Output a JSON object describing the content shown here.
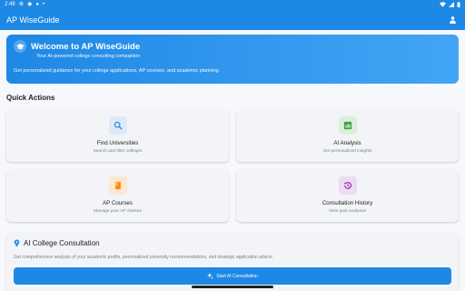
{
  "status_bar": {
    "time": "2:48"
  },
  "app_bar": {
    "title": "AP WiseGuide"
  },
  "welcome": {
    "title": "Welcome to AP WiseGuide",
    "subtitle": "Your AI-powered college consulting companion",
    "description": "Get personalized guidance for your college applications, AP courses, and academic planning."
  },
  "quick_actions": {
    "title": "Quick Actions",
    "cards": [
      {
        "title": "Find Universities",
        "subtitle": "Search and filter colleges",
        "icon": "search-icon",
        "icon_bg": "#dde9f7",
        "icon_color": "#1e88e5"
      },
      {
        "title": "AI Analysis",
        "subtitle": "Get personalized insights",
        "icon": "analytics-icon",
        "icon_bg": "#dcefdc",
        "icon_color": "#43a047"
      },
      {
        "title": "AP Courses",
        "subtitle": "Manage your AP classes",
        "icon": "book-icon",
        "icon_bg": "#fbe7d2",
        "icon_color": "#fb8c00"
      },
      {
        "title": "Consultation History",
        "subtitle": "View past analyses",
        "icon": "history-icon",
        "icon_bg": "#ecdcf2",
        "icon_color": "#8e24aa"
      }
    ]
  },
  "consultation": {
    "title": "AI College Consultation",
    "description": "Get comprehensive analysis of your academic profile, personalized university recommendations, and strategic application advice.",
    "button_label": "Start AI Consultation"
  },
  "colors": {
    "primary": "#1e88e5",
    "background": "#f6f8fb"
  }
}
